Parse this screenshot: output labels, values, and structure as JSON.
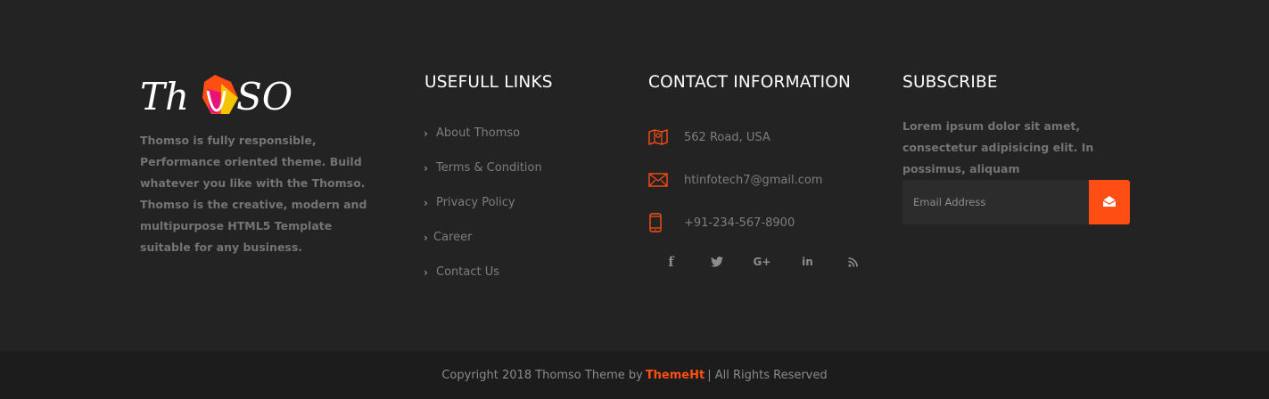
{
  "brand": {
    "logo_text_left": "Th",
    "logo_text_right": "SO",
    "logo_alt": "Thomso",
    "about": "Thomso is fully responsible, Performance oriented theme. Build whatever you like with the Thomso. Thomso is the creative, modern and multipurpose HTML5 Template suitable for any business."
  },
  "links": {
    "heading": "USEFULL LINKS",
    "items": [
      {
        "label": "About Thomso",
        "icon": "chevron-right-icon"
      },
      {
        "label": "Terms & Condition",
        "icon": "chevron-right-icon"
      },
      {
        "label": "Privacy Policy",
        "icon": "chevron-right-icon"
      },
      {
        "label": "Career",
        "icon": "chevron-right-icon"
      },
      {
        "label": "Contact Us",
        "icon": "chevron-right-icon"
      }
    ]
  },
  "contact": {
    "heading": "CONTACT INFORMATION",
    "address": "562 Road, USA",
    "email": "htinfotech7@gmail.com",
    "phone": "+91-234-567-8900",
    "social": [
      {
        "icon": "facebook-icon",
        "glyph": "f"
      },
      {
        "icon": "twitter-icon",
        "glyph": "🐦"
      },
      {
        "icon": "google-plus-icon",
        "glyph": "G+"
      },
      {
        "icon": "linkedin-icon",
        "glyph": "in"
      },
      {
        "icon": "rss-icon",
        "glyph": "rss"
      }
    ]
  },
  "subscribe": {
    "heading": "SUBSCRIBE",
    "text": "Lorem ipsum dolor sit amet, consectetur adipisicing elit. In possimus, aliquam",
    "placeholder": "Email Address",
    "button_icon": "envelope-open-icon"
  },
  "copyright": {
    "prefix": "Copyright 2018 Thomso Theme by",
    "link": "ThemeHt",
    "suffix": "| All Rights Reserved"
  },
  "colors": {
    "background": "#232323",
    "bottom_bar": "#1c1c1c",
    "accent": "#ff4e14",
    "heading": "#ffffff",
    "body_text": "#7b7b7b"
  }
}
